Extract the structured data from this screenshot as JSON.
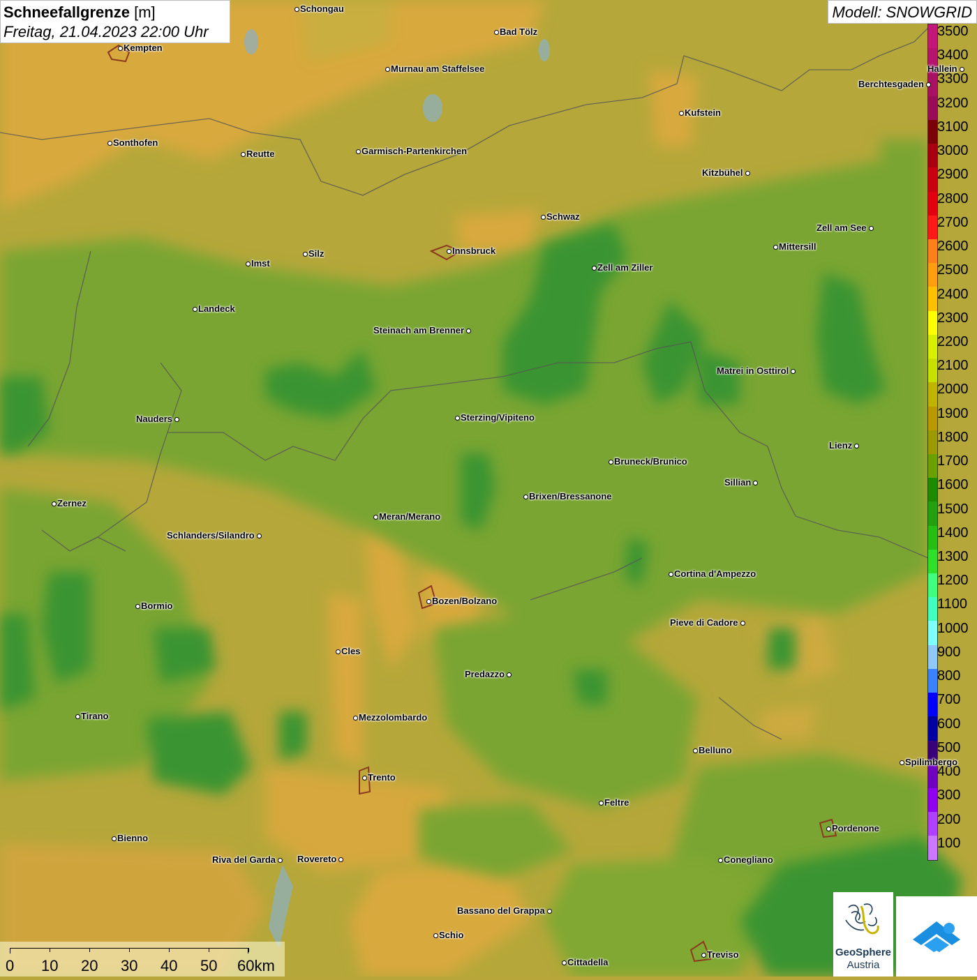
{
  "title": {
    "variable": "Schneefallgrenze",
    "unit": "[m]",
    "datetime": "Freitag, 21.04.2023 22:00 Uhr"
  },
  "model": "Modell: SNOWGRID",
  "legend": {
    "labels": [
      "3500",
      "3400",
      "3300",
      "3200",
      "3100",
      "3000",
      "2900",
      "2800",
      "2700",
      "2600",
      "2500",
      "2400",
      "2300",
      "2200",
      "2100",
      "2000",
      "1900",
      "1800",
      "1700",
      "1600",
      "1500",
      "1400",
      "1300",
      "1200",
      "1100",
      "1000",
      "900",
      "800",
      "700",
      "600",
      "500",
      "400",
      "300",
      "200",
      "100"
    ],
    "colors": [
      "#c2187a",
      "#b5146f",
      "#a81064",
      "#990c5a",
      "#7a0008",
      "#a80010",
      "#c8000f",
      "#e0000f",
      "#ff1a1a",
      "#ff7f1a",
      "#ff9f10",
      "#ffc000",
      "#ffff00",
      "#d8f000",
      "#c8e000",
      "#bfb400",
      "#b89a00",
      "#9c9a00",
      "#6aa000",
      "#1e8a00",
      "#22a010",
      "#26be12",
      "#2ee02a",
      "#40ff80",
      "#40ffc0",
      "#80ffff",
      "#90c8f8",
      "#3c82ff",
      "#0000ff",
      "#0000a0",
      "#3a007a",
      "#7000c0",
      "#9000f0",
      "#b040ff",
      "#cc77ff"
    ]
  },
  "cities": [
    {
      "name": "Schongau",
      "dot": "left"
    },
    {
      "name": "Bad Tölz",
      "dot": "left"
    },
    {
      "name": "Kempten",
      "dot": "left"
    },
    {
      "name": "Murnau am Staffelsee",
      "dot": "left"
    },
    {
      "name": "Hallein",
      "dot": "right"
    },
    {
      "name": "Berchtesgaden",
      "dot": "right"
    },
    {
      "name": "Kufstein",
      "dot": "left"
    },
    {
      "name": "Sonthofen",
      "dot": "left"
    },
    {
      "name": "Reutte",
      "dot": "left"
    },
    {
      "name": "Garmisch-Partenkirchen",
      "dot": "left"
    },
    {
      "name": "Kitzbühel",
      "dot": "right"
    },
    {
      "name": "Schwaz",
      "dot": "left"
    },
    {
      "name": "Zell am See",
      "dot": "right"
    },
    {
      "name": "Innsbruck",
      "dot": "left"
    },
    {
      "name": "Mittersill",
      "dot": "left"
    },
    {
      "name": "Imst",
      "dot": "left"
    },
    {
      "name": "Silz",
      "dot": "left"
    },
    {
      "name": "Zell am Ziller",
      "dot": "left"
    },
    {
      "name": "Landeck",
      "dot": "left"
    },
    {
      "name": "Steinach am Brenner",
      "dot": "right"
    },
    {
      "name": "Matrei in Osttirol",
      "dot": "right"
    },
    {
      "name": "Nauders",
      "dot": "right"
    },
    {
      "name": "Sterzing/Vipiteno",
      "dot": "left"
    },
    {
      "name": "Lienz",
      "dot": "right"
    },
    {
      "name": "Bruneck/Brunico",
      "dot": "left"
    },
    {
      "name": "Sillian",
      "dot": "right"
    },
    {
      "name": "Zernez",
      "dot": "left"
    },
    {
      "name": "Brixen/Bressanone",
      "dot": "left"
    },
    {
      "name": "Meran/Merano",
      "dot": "left"
    },
    {
      "name": "Schlanders/Silandro",
      "dot": "right"
    },
    {
      "name": "Cortina d'Ampezzo",
      "dot": "left"
    },
    {
      "name": "Bozen/Bolzano",
      "dot": "left"
    },
    {
      "name": "Bormio",
      "dot": "left"
    },
    {
      "name": "Pieve di Cadore",
      "dot": "right"
    },
    {
      "name": "Cles",
      "dot": "left"
    },
    {
      "name": "Predazzo",
      "dot": "right"
    },
    {
      "name": "Tirano",
      "dot": "left"
    },
    {
      "name": "Mezzolombardo",
      "dot": "left"
    },
    {
      "name": "Belluno",
      "dot": "left"
    },
    {
      "name": "Spilimbergo",
      "dot": "left"
    },
    {
      "name": "Trento",
      "dot": "left"
    },
    {
      "name": "Feltre",
      "dot": "left"
    },
    {
      "name": "Pordenone",
      "dot": "left"
    },
    {
      "name": "Bienno",
      "dot": "left"
    },
    {
      "name": "Riva del Garda",
      "dot": "right"
    },
    {
      "name": "Rovereto",
      "dot": "right"
    },
    {
      "name": "Conegliano",
      "dot": "left"
    },
    {
      "name": "Bassano del Grappa",
      "dot": "right"
    },
    {
      "name": "Schio",
      "dot": "left"
    },
    {
      "name": "Treviso",
      "dot": "left"
    },
    {
      "name": "Cittadella",
      "dot": "left"
    }
  ],
  "scalebar": {
    "labels": [
      "0",
      "10",
      "20",
      "30",
      "40",
      "50",
      "60km"
    ]
  },
  "logos": {
    "geosphere_line1": "GeoSphere",
    "geosphere_line2": "Austria"
  }
}
